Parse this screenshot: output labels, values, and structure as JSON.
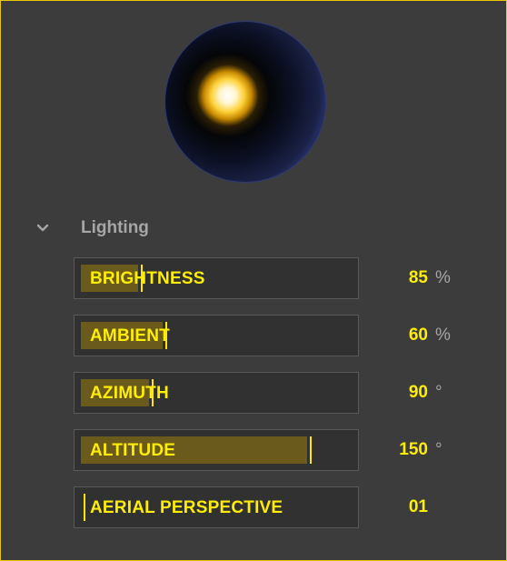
{
  "section": {
    "title": "Lighting",
    "expanded": true,
    "chevron_icon": "chevron-down-icon"
  },
  "colors": {
    "accent": "#ffee00",
    "frame": "#e8c800",
    "background": "#3c3c3c",
    "fill": "#6a5b1d"
  },
  "sliders": [
    {
      "label": "BRIGHTNESS",
      "value": "85",
      "unit": "%",
      "fill_fraction": 0.21
    },
    {
      "label": "AMBIENT",
      "value": "60",
      "unit": "%",
      "fill_fraction": 0.3
    },
    {
      "label": "AZIMUTH",
      "value": "90",
      "unit": "°",
      "fill_fraction": 0.25
    },
    {
      "label": "ALTITUDE",
      "value": "150",
      "unit": "°",
      "fill_fraction": 0.83
    },
    {
      "label": "AERIAL PERSPECTIVE",
      "value": "01",
      "unit": "",
      "fill_fraction": 0.0
    }
  ]
}
